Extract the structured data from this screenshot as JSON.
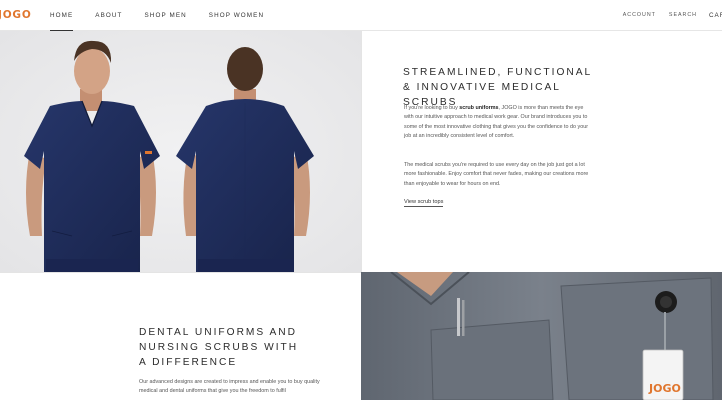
{
  "header": {
    "logo": "JOGO",
    "nav": [
      {
        "label": "HOME",
        "active": true
      },
      {
        "label": "ABOUT",
        "active": false
      },
      {
        "label": "SHOP MEN",
        "active": false
      },
      {
        "label": "SHOP WOMEN",
        "active": false
      }
    ],
    "account": "ACCOUNT",
    "search": "SEARCH",
    "cart": "CART"
  },
  "section1": {
    "image": "model-front-back-navy-scrubs",
    "headline": "STREAMLINED, FUNCTIONAL & INNOVATIVE MEDICAL SCRUBS",
    "para1_pre": "If you're looking to buy ",
    "para1_bold": "scrub uniforms",
    "para1_post": ", JOGO is more than meets the eye with our intuitive approach to medical work gear. Our brand introduces you to some of the most innovative clothing that gives you the confidence to do your job at an incredibly consistent level of comfort.",
    "para2": "The medical scrubs you're required to use every day on the job just got a lot more fashionable. Enjoy comfort that never fades, making our creations more than enjoyable to wear for hours on end.",
    "link": "View scrub tops"
  },
  "section2": {
    "headline": "DENTAL UNIFORMS AND NURSING SCRUBS WITH A DIFFERENCE",
    "para": "Our advanced designs are created to impress and enable you to buy quality medical and dental uniforms that give you the freedom to fulfil",
    "image": "grey-scrub-closeup-with-badge",
    "badge_text": "JOGO"
  },
  "colors": {
    "accent": "#e0762e",
    "navy": "#1f2d56",
    "grey_scrub": "#6f7680"
  }
}
